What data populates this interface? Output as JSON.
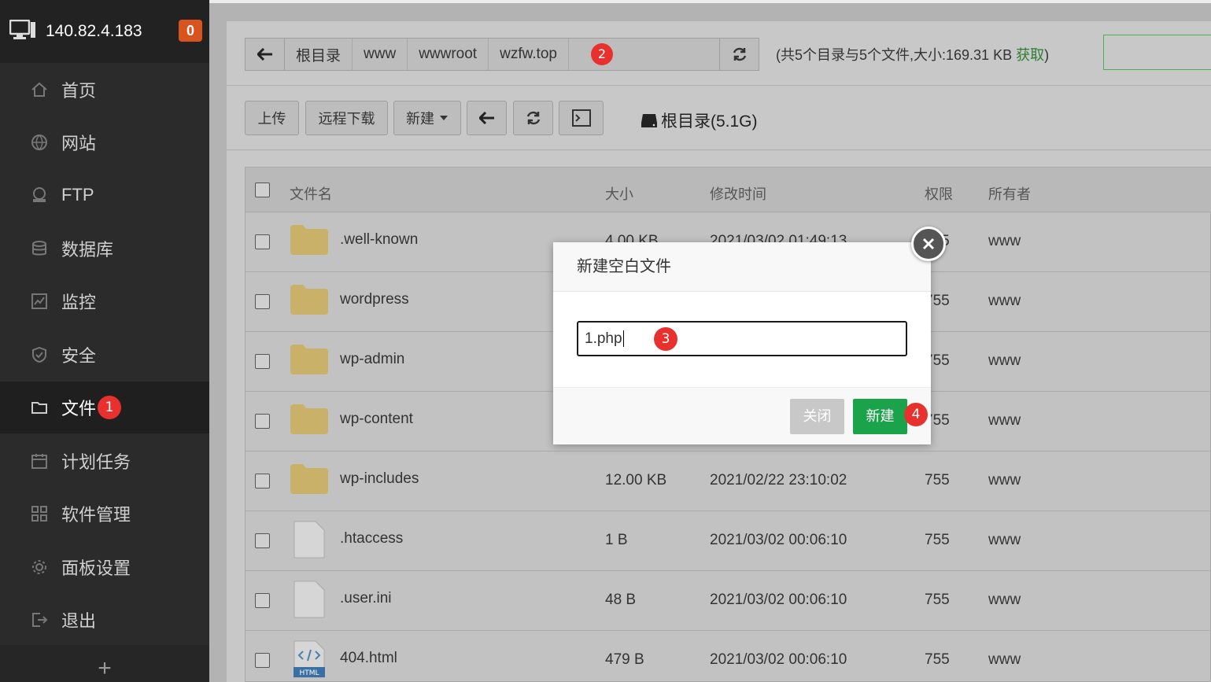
{
  "server": {
    "ip": "140.82.4.183",
    "alert_count": "0"
  },
  "sidebar": {
    "items": [
      {
        "label": "首页",
        "icon": "home-icon"
      },
      {
        "label": "网站",
        "icon": "globe-icon"
      },
      {
        "label": "FTP",
        "icon": "ftp-icon"
      },
      {
        "label": "数据库",
        "icon": "database-icon"
      },
      {
        "label": "监控",
        "icon": "monitor-icon"
      },
      {
        "label": "安全",
        "icon": "shield-icon"
      },
      {
        "label": "文件",
        "icon": "folder-icon",
        "active": true,
        "step": "1"
      },
      {
        "label": "计划任务",
        "icon": "calendar-icon"
      },
      {
        "label": "软件管理",
        "icon": "apps-icon"
      },
      {
        "label": "面板设置",
        "icon": "gear-icon"
      },
      {
        "label": "退出",
        "icon": "logout-icon"
      }
    ],
    "add_label": "+"
  },
  "breadcrumb": {
    "segments": [
      "根目录",
      "www",
      "wwwroot",
      "wzfw.top"
    ],
    "step": "2"
  },
  "summary": {
    "text": "(共5个目录与5个文件,大小:169.31 KB ",
    "get_label": "获取",
    "close_paren": ")"
  },
  "toolbar": {
    "upload": "上传",
    "remote_download": "远程下载",
    "new": "新建",
    "disk_label": "根目录(5.1G)"
  },
  "table": {
    "headers": {
      "name": "文件名",
      "size": "大小",
      "mtime": "修改时间",
      "perm": "权限",
      "owner": "所有者"
    },
    "rows": [
      {
        "name": ".well-known",
        "type": "folder",
        "size": "4.00 KB",
        "mtime": "2021/03/02 01:49:13",
        "perm": "755",
        "owner": "www"
      },
      {
        "name": "wordpress",
        "type": "folder",
        "size": "",
        "mtime": "",
        "perm": "755",
        "owner": "www"
      },
      {
        "name": "wp-admin",
        "type": "folder",
        "size": "",
        "mtime": "",
        "perm": "755",
        "owner": "www"
      },
      {
        "name": "wp-content",
        "type": "folder",
        "size": "",
        "mtime": "",
        "perm": "755",
        "owner": "www"
      },
      {
        "name": "wp-includes",
        "type": "folder",
        "size": "12.00 KB",
        "mtime": "2021/02/22 23:10:02",
        "perm": "755",
        "owner": "www"
      },
      {
        "name": ".htaccess",
        "type": "file",
        "size": "1 B",
        "mtime": "2021/03/02 00:06:10",
        "perm": "755",
        "owner": "www"
      },
      {
        "name": ".user.ini",
        "type": "file",
        "size": "48 B",
        "mtime": "2021/03/02 00:06:10",
        "perm": "755",
        "owner": "www"
      },
      {
        "name": "404.html",
        "type": "html",
        "size": "479 B",
        "mtime": "2021/03/02 00:06:10",
        "perm": "755",
        "owner": "www"
      }
    ]
  },
  "dialog": {
    "title": "新建空白文件",
    "input_value": "1.php",
    "input_step": "3",
    "close_label": "关闭",
    "create_label": "新建",
    "create_step": "4"
  },
  "colors": {
    "accent_green": "#1aa34a",
    "badge_red": "#e8312f",
    "alert_orange": "#d9531e"
  }
}
